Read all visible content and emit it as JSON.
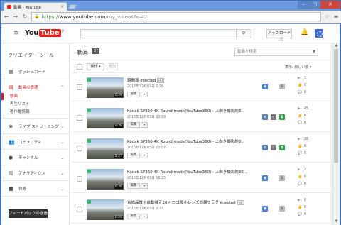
{
  "browser": {
    "tab_title": "動画 - YouTube",
    "tab_close": "×",
    "url_scheme": "https://",
    "url_host": "www.youtube.com",
    "url_path": "/my_videos?o=U",
    "controls": {
      "minimize": "–",
      "maximize": "□",
      "close": "✕"
    }
  },
  "header": {
    "logo_you": "You",
    "logo_tube": "Tube",
    "logo_suffix": "JP",
    "search_placeholder": "",
    "upload_label": "アップロード"
  },
  "sidebar": {
    "title": "クリエイター ツール",
    "dashboard": "ダッシュボード",
    "video_manager": "動画の管理",
    "sub_videos": "動画",
    "sub_playlists": "再生リスト",
    "sub_copyright": "著作権情報",
    "live": "ライブ ストリーミング",
    "community": "コミュニティ",
    "channel": "チャンネル",
    "analytics": "アナリティクス",
    "create": "作成",
    "feedback": "フィードバックの送信"
  },
  "main": {
    "title": "動画",
    "count": "87",
    "search_placeholder": "動画を検索",
    "action_label": "操作 ▾",
    "add_label": "追加",
    "display_label": "表示:",
    "sort_label": "新しい順 ▾"
  },
  "videos": [
    {
      "title": "鏡間湖 injected",
      "hd": "HD",
      "date": "2015年12月03日 0:36",
      "duration": "0:29",
      "views": "1",
      "likes": "0",
      "comments": "0",
      "edit": "編集",
      "icons": [
        "globe",
        "grey"
      ]
    },
    {
      "title": "Kodak SP360 4K Round mode(YouTube360) - 上向き撮影約3...",
      "hd": "",
      "date": "2015年12月03日 20:58",
      "duration": "0:26",
      "views": "45",
      "likes": "0",
      "comments": "0",
      "edit": "編集",
      "icons": [
        "gear",
        "check",
        "dollar"
      ]
    },
    {
      "title": "Kodak SP360 4K Round mode(YouTube360) - 上向き撮影約3...",
      "hd": "",
      "date": "2015年12月03日 20:57",
      "duration": "2:27",
      "views": "28",
      "likes": "0",
      "comments": "0",
      "edit": "編集",
      "icons": [
        "gear",
        "check",
        "dollar"
      ]
    },
    {
      "title": "Kodak SP360 4K Round mode(YouTube360) - 上向き撮影約30...",
      "hd": "",
      "date": "2015年12月03日 18:35",
      "duration": "0:26",
      "views": "2",
      "likes": "0",
      "comments": "0",
      "edit": "編集",
      "icons": [
        "globe",
        "grey"
      ]
    },
    {
      "title": "合成品質を自動補正20M ロゴ縦小レンズ効果フラグ injected",
      "hd": "HD",
      "date": "2015年12月03日 2:33",
      "duration": "0:26",
      "views": "0",
      "likes": "0",
      "comments": "0",
      "edit": "編集",
      "icons": [
        "globe",
        "grey"
      ]
    }
  ]
}
